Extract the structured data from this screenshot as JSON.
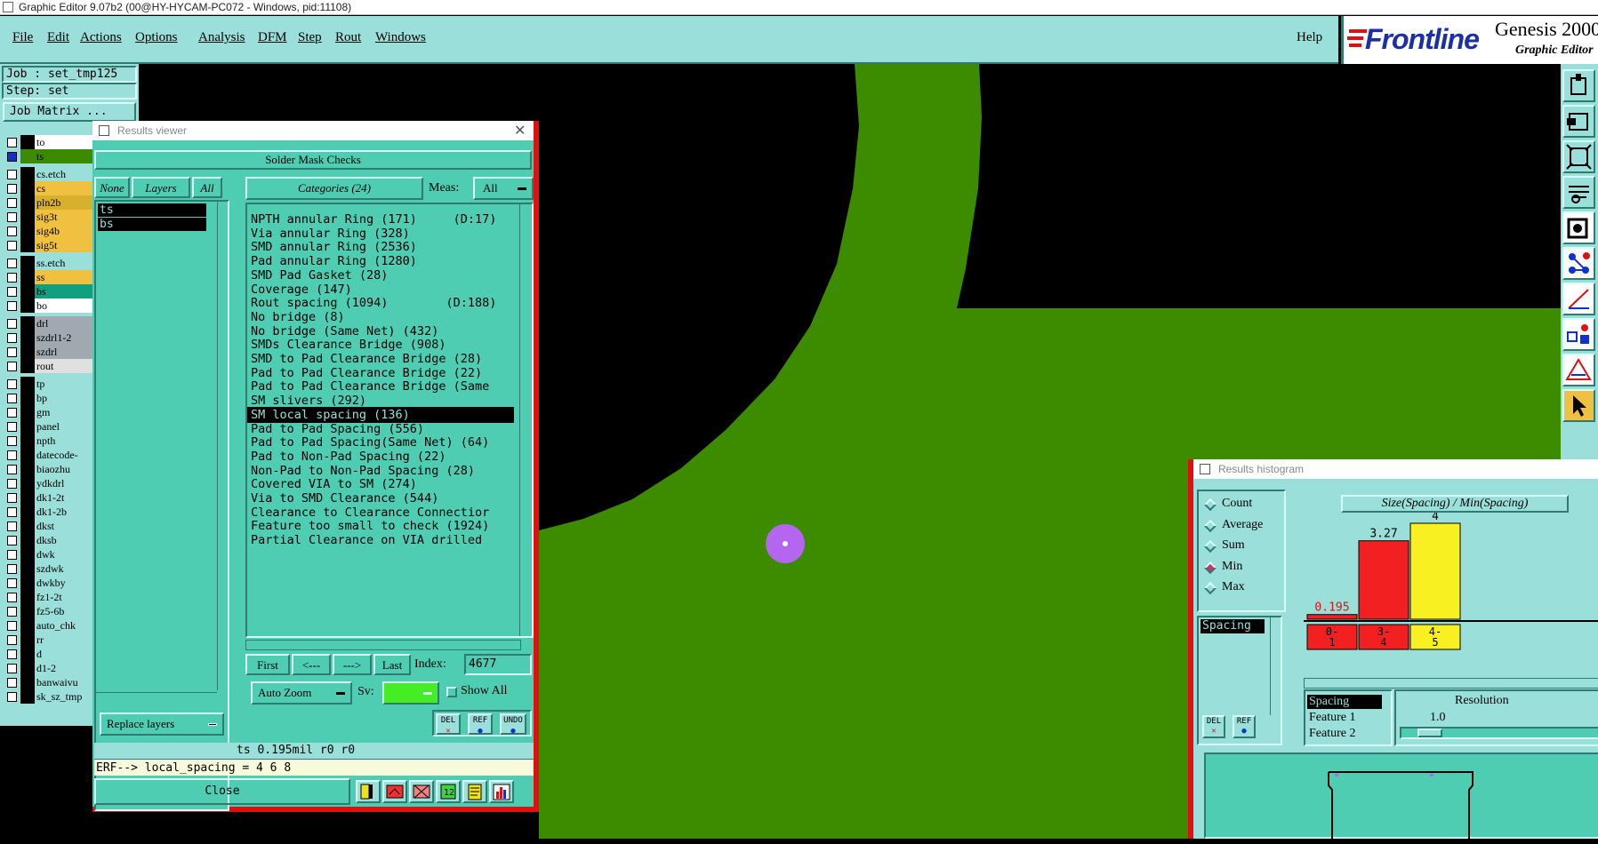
{
  "window": {
    "title": "Graphic Editor 9.07b2 (00@HY-HYCAM-PC072 - Windows, pid:11108)"
  },
  "menu": {
    "items": [
      "File",
      "Edit",
      "Actions",
      "Options",
      "Analysis",
      "DFM",
      "Step",
      "Rout",
      "Windows"
    ],
    "help": "Help"
  },
  "brand": {
    "logo": "Frontline",
    "product": "Genesis 2000",
    "subtitle": "Graphic Editor"
  },
  "job": {
    "job_line": "Job : set_tmp125",
    "step_line": "Step: set",
    "matrix_button": "Job Matrix ..."
  },
  "layers": [
    {
      "name": "to",
      "color": "#000000",
      "bg": "#ffffff",
      "checked": false
    },
    {
      "name": "ts",
      "color": "#3c8a00",
      "bg": "#3c8a00",
      "checked": true
    },
    {
      "name": "cs.etch",
      "color": "#000000",
      "bg": "#9adfd9",
      "checked": false
    },
    {
      "name": "cs",
      "color": "#f0c040",
      "bg": "#f0c040",
      "checked": false
    },
    {
      "name": "pln2b",
      "color": "#d8b030",
      "bg": "#d8b030",
      "checked": false
    },
    {
      "name": "sig3t",
      "color": "#f0c040",
      "bg": "#f0c040",
      "checked": false
    },
    {
      "name": "sig4b",
      "color": "#f0c040",
      "bg": "#f0c040",
      "checked": false
    },
    {
      "name": "sig5t",
      "color": "#f0c040",
      "bg": "#f0c040",
      "checked": false
    },
    {
      "name": "ss.etch",
      "color": "#000000",
      "bg": "#9adfd9",
      "checked": false
    },
    {
      "name": "ss",
      "color": "#f0c040",
      "bg": "#f0c040",
      "checked": false
    },
    {
      "name": "bs",
      "color": "#10a080",
      "bg": "#10a080",
      "checked": false
    },
    {
      "name": "bo",
      "color": "#000000",
      "bg": "#ffffff",
      "checked": false
    },
    {
      "name": "drl",
      "color": "#000000",
      "bg": "#a0a8b0",
      "checked": false
    },
    {
      "name": "szdrl1-2",
      "color": "#000000",
      "bg": "#a0a8b0",
      "checked": false
    },
    {
      "name": "szdrl",
      "color": "#000000",
      "bg": "#a0a8b0",
      "checked": false
    },
    {
      "name": "rout",
      "color": "#000000",
      "bg": "#e0e0e0",
      "checked": false
    },
    {
      "name": "tp",
      "color": "#000000",
      "bg": "#9adfd9",
      "checked": false
    },
    {
      "name": "bp",
      "color": "#000000",
      "bg": "#9adfd9",
      "checked": false
    },
    {
      "name": "gm",
      "color": "#000000",
      "bg": "#9adfd9",
      "checked": false
    },
    {
      "name": "panel",
      "color": "#000000",
      "bg": "#9adfd9",
      "checked": false
    },
    {
      "name": "npth",
      "color": "#000000",
      "bg": "#9adfd9",
      "checked": false
    },
    {
      "name": "datecode-",
      "color": "#000000",
      "bg": "#9adfd9",
      "checked": false
    },
    {
      "name": "biaozhu",
      "color": "#000000",
      "bg": "#9adfd9",
      "checked": false
    },
    {
      "name": "ydkdrl",
      "color": "#000000",
      "bg": "#9adfd9",
      "checked": false
    },
    {
      "name": "dk1-2t",
      "color": "#000000",
      "bg": "#9adfd9",
      "checked": false
    },
    {
      "name": "dk1-2b",
      "color": "#000000",
      "bg": "#9adfd9",
      "checked": false
    },
    {
      "name": "dkst",
      "color": "#000000",
      "bg": "#9adfd9",
      "checked": false
    },
    {
      "name": "dksb",
      "color": "#000000",
      "bg": "#9adfd9",
      "checked": false
    },
    {
      "name": "dwk",
      "color": "#000000",
      "bg": "#9adfd9",
      "checked": false
    },
    {
      "name": "szdwk",
      "color": "#000000",
      "bg": "#9adfd9",
      "checked": false
    },
    {
      "name": "dwkby",
      "color": "#000000",
      "bg": "#9adfd9",
      "checked": false
    },
    {
      "name": "fz1-2t",
      "color": "#000000",
      "bg": "#9adfd9",
      "checked": false
    },
    {
      "name": "fz5-6b",
      "color": "#000000",
      "bg": "#9adfd9",
      "checked": false
    },
    {
      "name": "auto_chk",
      "color": "#000000",
      "bg": "#9adfd9",
      "checked": false
    },
    {
      "name": "rr",
      "color": "#000000",
      "bg": "#9adfd9",
      "checked": false
    },
    {
      "name": "d",
      "color": "#000000",
      "bg": "#9adfd9",
      "checked": false
    },
    {
      "name": "d1-2",
      "color": "#000000",
      "bg": "#9adfd9",
      "checked": false
    },
    {
      "name": "banwaivu",
      "color": "#000000",
      "bg": "#9adfd9",
      "checked": false
    },
    {
      "name": "sk_sz_tmp",
      "color": "#000000",
      "bg": "#9adfd9",
      "checked": false
    }
  ],
  "results_viewer": {
    "title": "Results viewer",
    "header": "Solder Mask Checks",
    "none_btn": "None",
    "layers_btn": "Layers",
    "all_btn": "All",
    "layer_list": [
      "ts",
      "bs"
    ],
    "categories_btn": "Categories (24)",
    "meas_label": "Meas:",
    "meas_value": "All",
    "categories": [
      "NPTH annular Ring (171)     (D:17)",
      "Via annular Ring (328)",
      "SMD annular Ring (2536)",
      "Pad annular Ring (1280)",
      "SMD Pad Gasket (28)",
      "Coverage (147)",
      "Rout spacing (1094)        (D:188)",
      "No bridge (8)",
      "No bridge (Same Net) (432)",
      "SMDs Clearance Bridge (908)",
      "SMD to Pad Clearance Bridge (28)",
      "Pad to Pad Clearance Bridge (22)",
      "Pad to Pad Clearance Bridge (Same",
      "SM slivers (292)",
      "SM local spacing (136)",
      "Pad to Pad Spacing (556)",
      "Pad to Pad Spacing(Same Net) (64)",
      "Pad to Non-Pad Spacing (22)",
      "Non-Pad to Non-Pad Spacing (28)",
      "Covered VIA to SM (274)",
      "Via to SMD Clearance (544)",
      "Clearance to Clearance Connectior",
      "Feature too small to check (1924)",
      "Partial Clearance on VIA drilled"
    ],
    "selected_index": 14,
    "nav": {
      "first": "First",
      "prev": "<---",
      "next": "--->",
      "last": "Last",
      "index_label": "Index:",
      "index_value": "4677"
    },
    "auto_zoom": "Auto Zoom",
    "sv_label": "Sv:",
    "show_all": "Show All",
    "replace_layers": "Replace layers",
    "small_btns": [
      "DEL",
      "REF",
      "UNDO"
    ],
    "status": "ts 0.195mil  r0  r0",
    "erf": "ERF--> local_spacing = 4 6 8",
    "close": "Close"
  },
  "histogram": {
    "title": "Results histogram",
    "options": [
      "Count",
      "Average",
      "Sum",
      "Min",
      "Max"
    ],
    "selected_option": "Min",
    "heading": "Size(Spacing) / Min(Spacing)",
    "list_left": [
      "Spacing"
    ],
    "bars": [
      {
        "label": "0-\n1",
        "value": 0.195,
        "value_text": "0.195",
        "color": "#f22020"
      },
      {
        "label": "3-\n4",
        "value": 3.27,
        "value_text": "3.27",
        "color": "#f22020"
      },
      {
        "label": "4-\n5",
        "value": 4,
        "value_text": "4",
        "color": "#f8f020"
      }
    ],
    "ymax": 4,
    "fields": [
      "Spacing",
      "Feature 1",
      "Feature 2"
    ],
    "resolution_label": "Resolution",
    "resolution_value": "1.0",
    "small_btns": [
      "DEL",
      "REF"
    ]
  },
  "colors": {
    "board_green": "#3d8c00",
    "marker": "#b466f0",
    "accent_red": "#e01010",
    "panel_teal": "#4fcdb3"
  }
}
